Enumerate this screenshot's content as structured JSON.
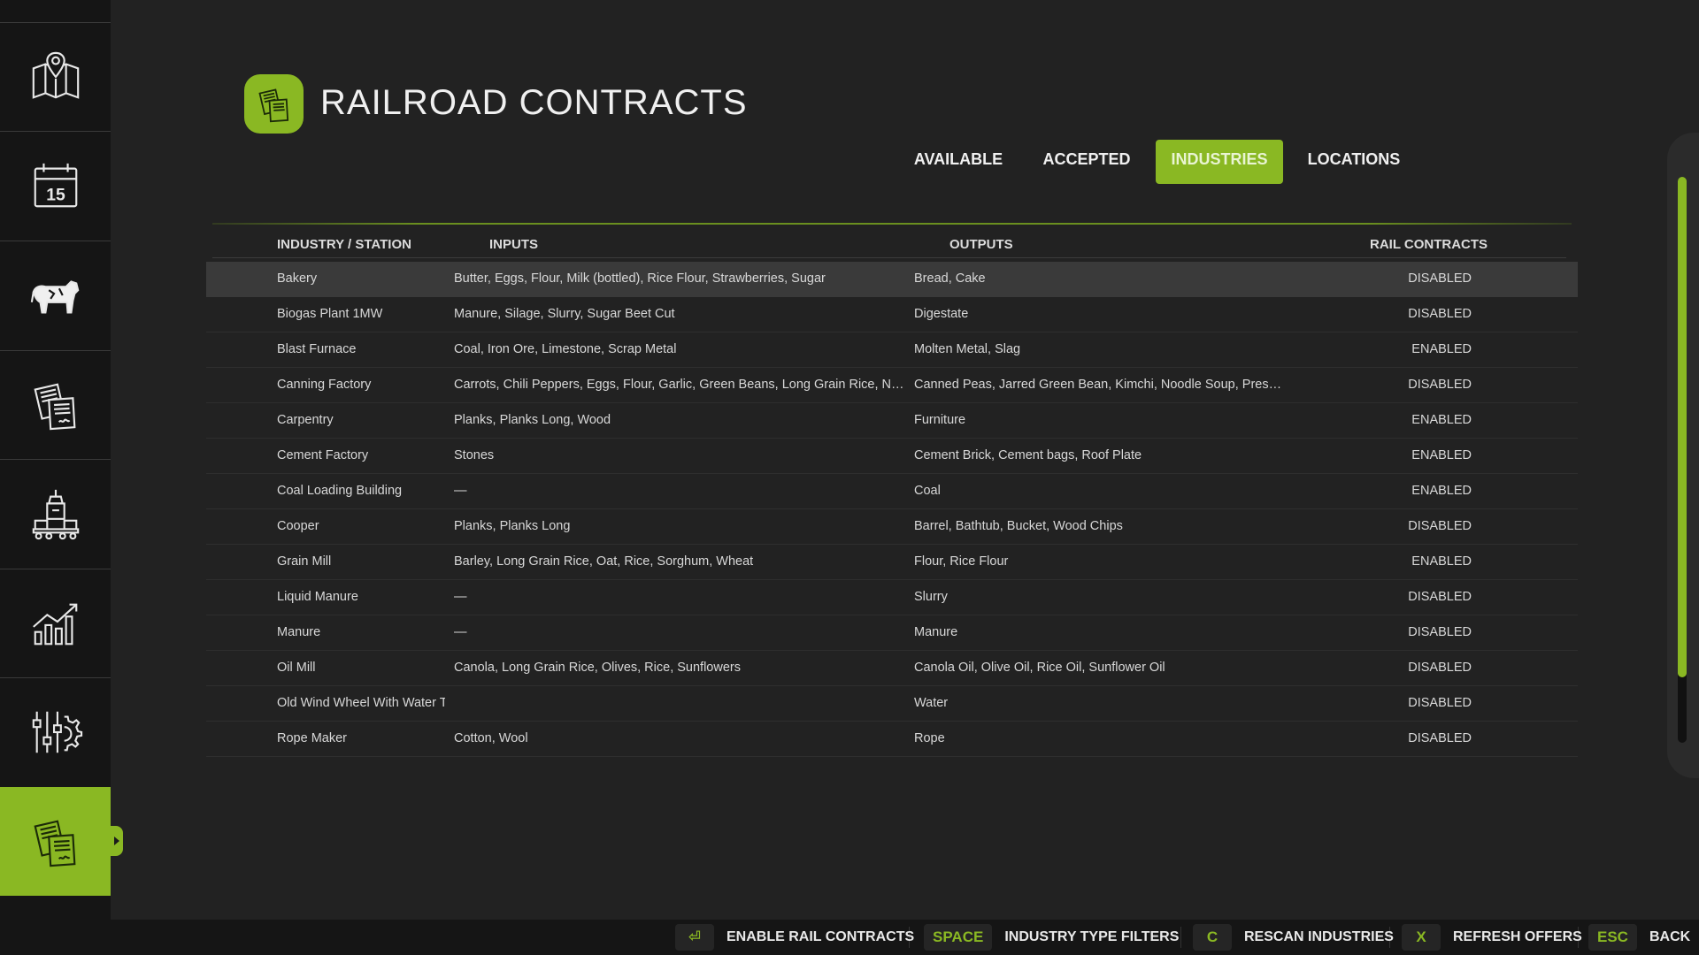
{
  "header": {
    "title": "RAILROAD CONTRACTS"
  },
  "sidebar": {
    "items": [
      {
        "icon": "map-icon"
      },
      {
        "icon": "calendar-icon",
        "label": "15"
      },
      {
        "icon": "cow-icon"
      },
      {
        "icon": "contracts-icon"
      },
      {
        "icon": "production-icon"
      },
      {
        "icon": "statistics-icon"
      },
      {
        "icon": "settings-icon"
      },
      {
        "icon": "railroad-contracts-icon",
        "active": true
      }
    ]
  },
  "tabs": [
    {
      "label": "AVAILABLE"
    },
    {
      "label": "ACCEPTED"
    },
    {
      "label": "INDUSTRIES",
      "active": true
    },
    {
      "label": "LOCATIONS"
    }
  ],
  "table": {
    "headers": {
      "industry": "INDUSTRY / STATION",
      "inputs": "INPUTS",
      "outputs": "OUTPUTS",
      "rail": "RAIL CONTRACTS"
    },
    "rows": [
      {
        "name": "Bakery",
        "inputs": "Butter, Eggs, Flour, Milk (bottled), Rice Flour, Strawberries, Sugar",
        "outputs": "Bread, Cake",
        "status": "DISABLED"
      },
      {
        "name": "Biogas Plant 1MW",
        "inputs": "Manure, Silage, Slurry, Sugar Beet Cut",
        "outputs": "Digestate",
        "status": "DISABLED"
      },
      {
        "name": "Blast Furnace",
        "inputs": "Coal, Iron Ore, Limestone, Scrap Metal",
        "outputs": "Molten Metal, Slag",
        "status": "ENABLED"
      },
      {
        "name": "Canning Factory",
        "inputs": "Carrots, Chili Peppers, Eggs, Flour, Garlic, Green Beans, Long Grain Rice, Napa ...",
        "outputs": "Canned Peas, Jarred Green Bean, Kimchi, Noodle Soup, Preserve...",
        "status": "DISABLED"
      },
      {
        "name": "Carpentry",
        "inputs": "Planks, Planks Long, Wood",
        "outputs": "Furniture",
        "status": "ENABLED"
      },
      {
        "name": "Cement Factory",
        "inputs": "Stones",
        "outputs": "Cement Brick, Cement bags, Roof Plate",
        "status": "ENABLED"
      },
      {
        "name": "Coal Loading Building",
        "inputs": "—",
        "outputs": "Coal",
        "status": "ENABLED"
      },
      {
        "name": "Cooper",
        "inputs": "Planks, Planks Long",
        "outputs": "Barrel, Bathtub, Bucket, Wood Chips",
        "status": "DISABLED"
      },
      {
        "name": "Grain Mill",
        "inputs": "Barley, Long Grain Rice, Oat, Rice, Sorghum, Wheat",
        "outputs": "Flour, Rice Flour",
        "status": "ENABLED"
      },
      {
        "name": "Liquid Manure",
        "inputs": "—",
        "outputs": "Slurry",
        "status": "DISABLED"
      },
      {
        "name": "Manure",
        "inputs": "—",
        "outputs": "Manure",
        "status": "DISABLED"
      },
      {
        "name": "Oil Mill",
        "inputs": "Canola, Long Grain Rice, Olives, Rice, Sunflowers",
        "outputs": "Canola Oil, Olive Oil, Rice Oil, Sunflower Oil",
        "status": "DISABLED"
      },
      {
        "name": "Old Wind Wheel With Water Tank",
        "inputs": "",
        "outputs": "Water",
        "status": "DISABLED"
      },
      {
        "name": "Rope Maker",
        "inputs": "Cotton, Wool",
        "outputs": "Rope",
        "status": "DISABLED"
      }
    ],
    "selected_row": 0
  },
  "bottom_bar": {
    "hints": [
      {
        "key": "⏎",
        "label": "ENABLE RAIL CONTRACTS"
      },
      {
        "key": "SPACE",
        "label": "INDUSTRY TYPE FILTERS"
      },
      {
        "key": "C",
        "label": "RESCAN INDUSTRIES"
      },
      {
        "key": "X",
        "label": "REFRESH OFFERS"
      },
      {
        "key": "ESC",
        "label": "BACK"
      }
    ]
  },
  "colors": {
    "accent": "#8ab823",
    "background": "#222222",
    "sidebar": "#151515"
  }
}
